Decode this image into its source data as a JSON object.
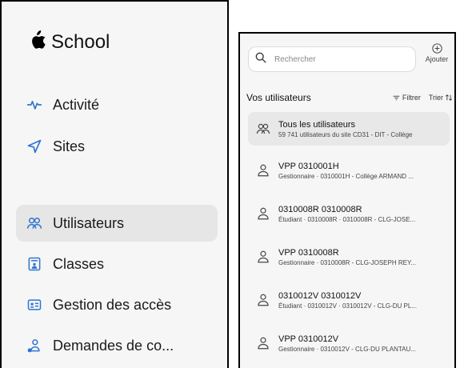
{
  "sidebar": {
    "brand": {
      "logo_glyph": "",
      "name": "School"
    },
    "items": [
      {
        "label": "Activité",
        "icon": "activity-icon",
        "active": false
      },
      {
        "label": "Sites",
        "icon": "location-arrow-icon",
        "active": false
      },
      {
        "label": "Utilisateurs",
        "icon": "users-icon",
        "active": true
      },
      {
        "label": "Classes",
        "icon": "classroom-icon",
        "active": false
      },
      {
        "label": "Gestion des accès",
        "icon": "id-card-icon",
        "active": false
      },
      {
        "label": "Demandes de co...",
        "icon": "person-request-icon",
        "active": false
      }
    ]
  },
  "panel": {
    "search": {
      "placeholder": "Rechercher"
    },
    "add_label": "Ajouter",
    "list_title": "Vos utilisateurs",
    "filter_label": "Filtrer",
    "sort_label": "Trier",
    "rows": [
      {
        "primary": "Tous les utilisateurs",
        "secondary": "59 741 utilisateurs du site CD31 - DIT - Collège",
        "icon": "users-icon"
      },
      {
        "primary": "VPP 0310001H",
        "secondary": "Gestionnaire · 0310001H - Collège ARMAND ...",
        "icon": "person-icon"
      },
      {
        "primary": "0310008R 0310008R",
        "secondary": "Étudiant · 0310008R · 0310008R - CLG-JOSE...",
        "icon": "person-icon"
      },
      {
        "primary": "VPP 0310008R",
        "secondary": "Gestionnaire · 0310008R - CLG-JOSEPH REY...",
        "icon": "person-icon"
      },
      {
        "primary": "0310012V 0310012V",
        "secondary": "Étudiant · 0310012V · 0310012V - CLG-DU PL...",
        "icon": "person-icon"
      },
      {
        "primary": "VPP 0310012V",
        "secondary": "Gestionnaire · 0310012V - CLG-DU PLANTAU...",
        "icon": "person-icon"
      }
    ]
  },
  "colors": {
    "accent": "#2f74d0",
    "panel_bg": "#f6f6f6",
    "selected_bg": "#e6e6e6"
  }
}
